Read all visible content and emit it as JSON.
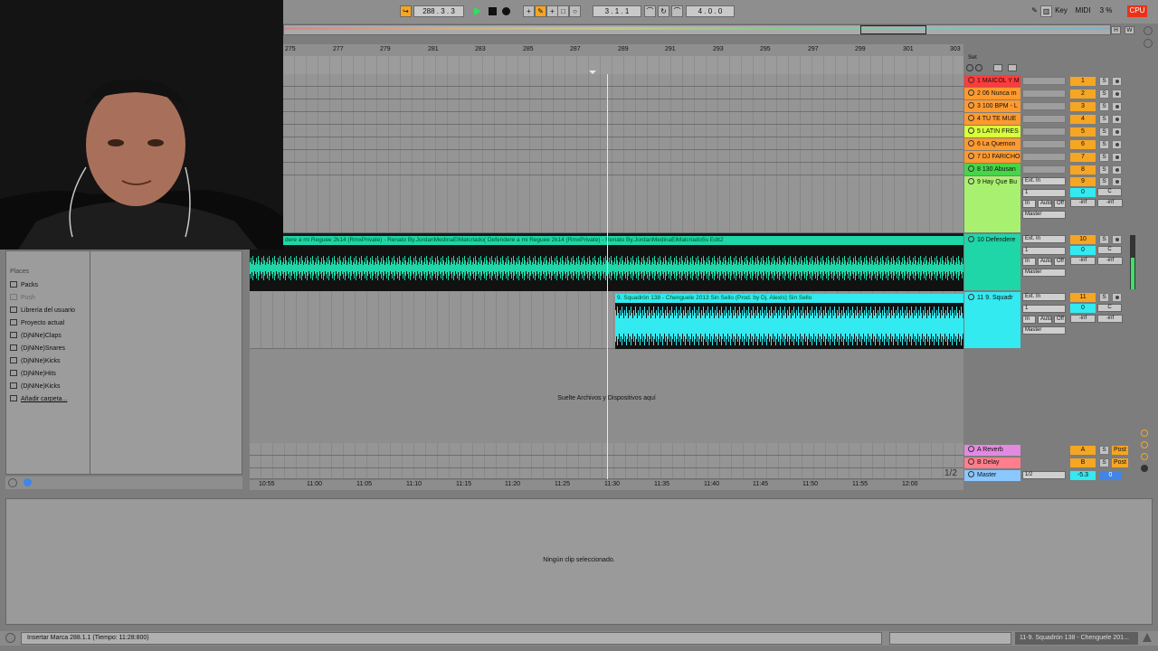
{
  "transport": {
    "follow_label": "↪",
    "position": "288 .  3 .  3",
    "play_icon": "play-icon",
    "stop_icon": "stop-icon",
    "record_icon": "record-icon",
    "loop_start": "3 .  1 .  1",
    "loop_length": "4 .  0 .  0",
    "key_label": "Key",
    "midi_label": "MIDI",
    "cpu_percent": "3 %",
    "cpu_label": "CPU",
    "h_label": "H",
    "w_label": "W"
  },
  "ruler": {
    "bars": [
      "275",
      "277",
      "279",
      "281",
      "283",
      "285",
      "287",
      "289",
      "291",
      "293",
      "295",
      "297",
      "299",
      "301",
      "303"
    ],
    "set_label": "Set"
  },
  "tracks": [
    {
      "name": "1 MAICOL Y M",
      "num": "1",
      "color": "#ff3b3b"
    },
    {
      "name": "2 06 Nunca m",
      "num": "2",
      "color": "#ff9a2e"
    },
    {
      "name": "3 100 BPM - L",
      "num": "3",
      "color": "#ff9a2e"
    },
    {
      "name": "4 TU TE MUE",
      "num": "4",
      "color": "#ff9a2e"
    },
    {
      "name": "5 LATIN FRES",
      "num": "5",
      "color": "#d7ff3a"
    },
    {
      "name": "6 La Quemon",
      "num": "6",
      "color": "#ff9a2e"
    },
    {
      "name": "7 DJ FARICHO",
      "num": "7",
      "color": "#ff9a2e"
    },
    {
      "name": "8 130 Abusan",
      "num": "8",
      "color": "#48d44a"
    }
  ],
  "audio_tracks": [
    {
      "name": "9 Hay Que Bu",
      "num": "9",
      "color": "#a8f070",
      "input": "Ext. In",
      "channel": "1",
      "monitor": [
        "In",
        "Auto",
        "Off"
      ],
      "out": "Master",
      "vol": "0",
      "pan": "C",
      "peak1": "-inf",
      "peak2": "-inf"
    },
    {
      "name": "10 Defendere",
      "num": "10",
      "color": "#1fd6a8",
      "input": "Ext. In",
      "channel": "1",
      "monitor": [
        "In",
        "Auto",
        "Off"
      ],
      "out": "Master",
      "vol": "0",
      "pan": "C",
      "peak1": "-inf",
      "peak2": "-inf"
    },
    {
      "name": "11 9. Squadr",
      "num": "11",
      "color": "#33eaf0",
      "input": "Ext. In",
      "channel": "1",
      "monitor": [
        "In",
        "Auto",
        "Off"
      ],
      "out": "Master",
      "vol": "0",
      "pan": "C",
      "peak1": "-inf",
      "peak2": "-inf"
    }
  ],
  "clips": {
    "defendere": "dere a mi Reguee 2k14 (RmxPrivate) - Renato By.JordanMedinaElMalcriado( Defendere a mi Reguee 2k14 (RmxPrivate) - Renato By.JordanMedinaElMalcriado5s Edit2",
    "squadron": "9. Squadrón 138 - Chenguele 2013 Sin Sello (Prod. by Dj. Alexis) Sin Sello"
  },
  "drop_hint": "Suelte Archivos y Dispositivos aquí",
  "returns": [
    {
      "name": "A Reverb",
      "num": "A",
      "color": "#e28ae0",
      "s": "S",
      "post": "Post"
    },
    {
      "name": "B Delay",
      "num": "B",
      "color": "#ff7d8c",
      "s": "S",
      "post": "Post"
    }
  ],
  "master": {
    "name": "Master",
    "out": "1/2",
    "vol": "-5.3",
    "pan": "0",
    "color": "#8ac8ff"
  },
  "page_indicator": "1/2",
  "time_ruler": [
    "10:55",
    "11:00",
    "11:05",
    "11:10",
    "11:15",
    "11:20",
    "11:25",
    "11:30",
    "11:35",
    "11:40",
    "11:45",
    "11:50",
    "11:55",
    "12:00"
  ],
  "browser": {
    "heading": "Places",
    "items": [
      "Packs",
      "Push",
      "Librería del usuario",
      "Proyecto actual",
      "(DjNiNe)Claps",
      "(DjNiNe)Snares",
      "(DjNiNe)Kicks",
      "(DjNiNe)Hits",
      "(DjNiNe)Kicks",
      "Añadir carpeta..."
    ]
  },
  "detail": {
    "message": "Ningún clip seleccionado."
  },
  "status": {
    "left": "Insertar Marca 288.1.1 (Tiempo: 11:28:800)",
    "right": "11-9. Squadrón 138 - Chenguele 201..."
  },
  "colors": {
    "accent": "#f5a623",
    "teal_clip": "#1fd6a8",
    "cyan_clip": "#33eaf0"
  }
}
